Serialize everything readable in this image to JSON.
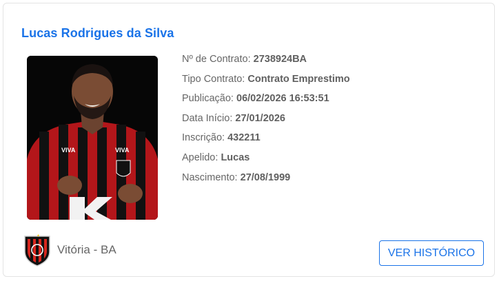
{
  "player": {
    "name": "Lucas Rodrigues da Silva",
    "photo": "player-photo"
  },
  "details": [
    {
      "label": "Nº de Contrato:",
      "value": "2738924BA"
    },
    {
      "label": "Tipo Contrato:",
      "value": "Contrato Emprestimo"
    },
    {
      "label": "Publicação:",
      "value": "06/02/2026 16:53:51"
    },
    {
      "label": "Data Início:",
      "value": "27/01/2026"
    },
    {
      "label": "Inscrição:",
      "value": "432211"
    },
    {
      "label": "Apelido:",
      "value": "Lucas"
    },
    {
      "label": "Nascimento:",
      "value": "27/08/1999"
    }
  ],
  "club": {
    "name": "Vitória - BA",
    "crest": "vitoria-crest-icon"
  },
  "actions": {
    "history_label": "VER HISTÓRICO"
  },
  "colors": {
    "accent": "#1a73e8",
    "text": "#666666",
    "club_red": "#d7261e",
    "club_black": "#111111"
  }
}
